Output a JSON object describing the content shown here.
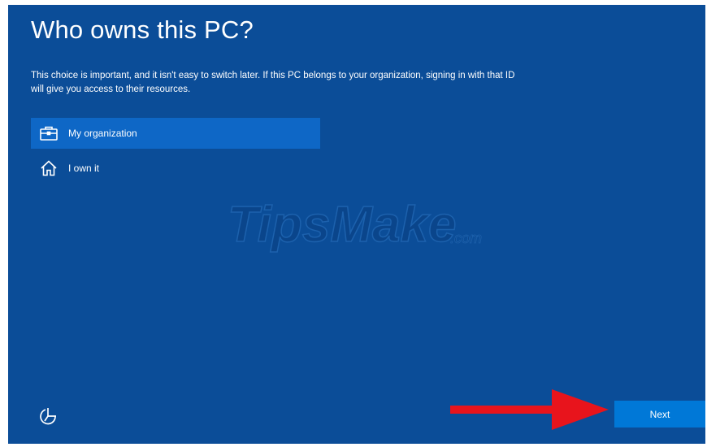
{
  "page": {
    "title": "Who owns this PC?",
    "description": "This choice is important, and it isn't easy to switch later. If this PC belongs to your organization, signing in with that ID will give you access to their resources."
  },
  "options": [
    {
      "label": "My organization",
      "icon": "briefcase-icon",
      "selected": true
    },
    {
      "label": "I own it",
      "icon": "home-icon",
      "selected": false
    }
  ],
  "footer": {
    "accessibility_icon": "accessibility-icon",
    "next_label": "Next"
  },
  "watermark": {
    "text": "TipsMake",
    "suffix": ".com"
  },
  "annotation": {
    "icon": "red-arrow"
  },
  "colors": {
    "background": "#0b4d98",
    "selected_option": "#0e67c6",
    "button": "#0078d7",
    "arrow": "#e8141c"
  }
}
